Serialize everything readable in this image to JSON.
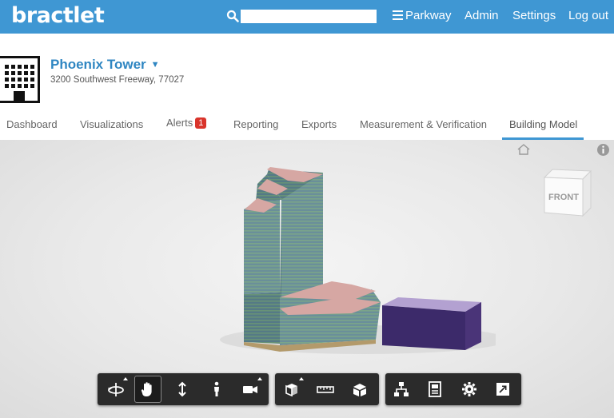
{
  "brand": {
    "logo": "bractlet",
    "color": "#3f97d3"
  },
  "search": {
    "placeholder": "",
    "value": ""
  },
  "nav": {
    "portfolio": "Parkway",
    "admin": "Admin",
    "settings": "Settings",
    "logout": "Log out"
  },
  "building": {
    "name": "Phoenix Tower",
    "address": "3200 Southwest Freeway, 77027"
  },
  "tabs": [
    {
      "label": "Dashboard"
    },
    {
      "label": "Visualizations"
    },
    {
      "label": "Alerts",
      "badge": "1"
    },
    {
      "label": "Reporting"
    },
    {
      "label": "Exports"
    },
    {
      "label": "Measurement & Verification"
    },
    {
      "label": "Building Model",
      "active": true
    }
  ],
  "viewcube": {
    "face": "FRONT"
  },
  "toolbar": {
    "groups": [
      [
        "orbit-icon",
        "pan-icon",
        "dolly-icon",
        "first-person-icon",
        "camera-icon"
      ],
      [
        "section-box-icon",
        "measure-icon",
        "explode-icon"
      ],
      [
        "model-browser-icon",
        "properties-icon",
        "settings-icon",
        "fullscreen-icon"
      ]
    ],
    "active": "pan-icon"
  }
}
